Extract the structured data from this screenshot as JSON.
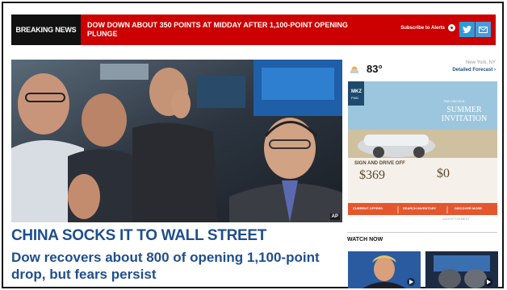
{
  "breaking": {
    "tag": "BREAKING NEWS",
    "headline": "DOW DOWN ABOUT 350 POINTS AT MIDDAY AFTER 1,100-POINT OPENING PLUNGE",
    "alerts_label": "Subscribe to Alerts"
  },
  "hero": {
    "credit": "AP"
  },
  "story": {
    "kicker": "CHINA SOCKS IT TO WALL STREET",
    "dek": "Dow recovers about 800 of opening 1,100-point drop, but fears persist"
  },
  "weather": {
    "temp": "83°",
    "location": "New York, NY",
    "forecast_link": "Detailed Forecast ›"
  },
  "ad": {
    "brand": "MKZ",
    "brand_sub": "FWD",
    "headline_small": "THE LINCOLN",
    "headline_big": "SUMMER INVITATION",
    "offer_line": "SIGN AND DRIVE OFF",
    "price": "$369",
    "zero": "$0",
    "btn1": "CURRENT OFFERS",
    "btn2": "SEARCH INVENTORY",
    "btn3": "DISCOVER MORE",
    "label": "ADVERTISEMENT"
  },
  "watch_now": {
    "title": "WATCH NOW"
  }
}
